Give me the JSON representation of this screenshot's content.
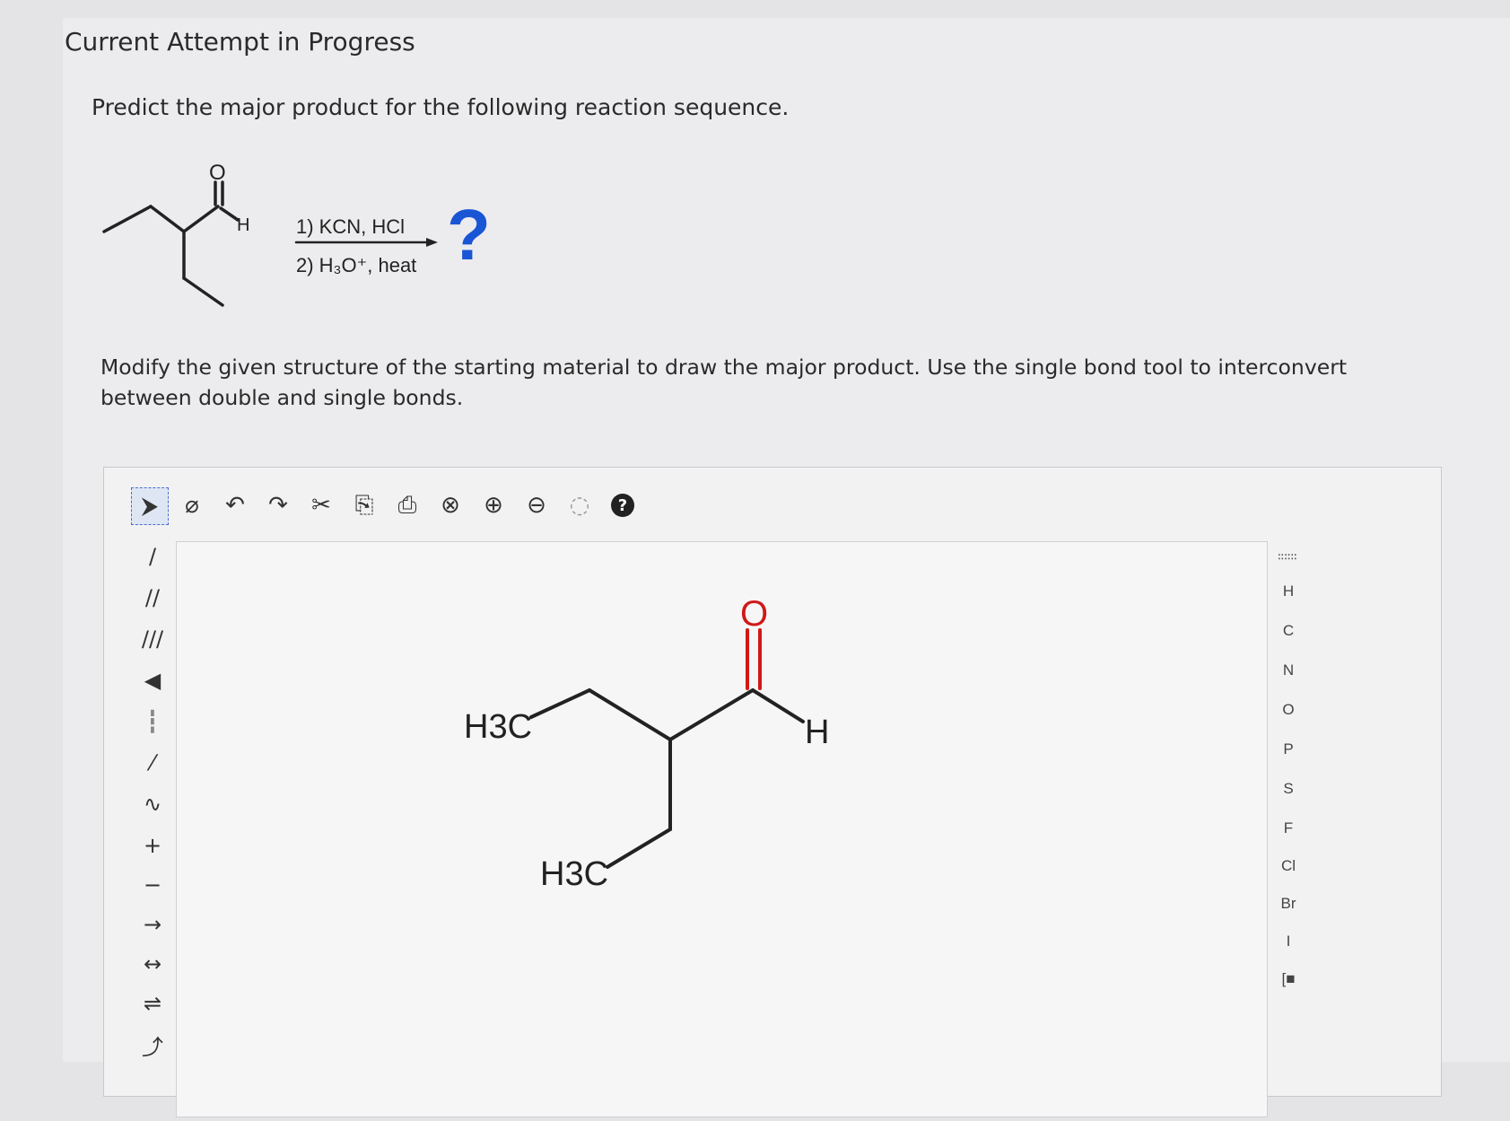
{
  "header": {
    "title": "Current Attempt in Progress"
  },
  "question": {
    "text": "Predict the major product for the following reaction sequence."
  },
  "reaction": {
    "reagent_1": "1) KCN, HCl",
    "reagent_2": "2) H₃O⁺, heat",
    "unknown": "?",
    "aldehyde_h": "H",
    "carbonyl_o": "O"
  },
  "instructions": {
    "text": "Modify the given structure of the starting material to draw the major product. Use the single bond tool to interconvert between double and single bonds."
  },
  "toolbar": {
    "items": [
      {
        "name": "select-tool-icon",
        "glyph": "⮞"
      },
      {
        "name": "eraser-icon",
        "glyph": "⌀"
      },
      {
        "name": "undo-icon",
        "glyph": "↶"
      },
      {
        "name": "redo-icon",
        "glyph": "↷"
      },
      {
        "name": "cut-icon",
        "glyph": "✂"
      },
      {
        "name": "copy-icon",
        "glyph": "⎘"
      },
      {
        "name": "paste-icon",
        "glyph": "⎙"
      },
      {
        "name": "zoom-reset-icon",
        "glyph": "⊗"
      },
      {
        "name": "zoom-in-icon",
        "glyph": "⊕"
      },
      {
        "name": "zoom-out-icon",
        "glyph": "⊖"
      },
      {
        "name": "zoom-fit-icon",
        "glyph": "◌"
      },
      {
        "name": "help-icon",
        "glyph": "?"
      }
    ]
  },
  "left_tools": {
    "items": [
      {
        "name": "single-bond-icon",
        "glyph": "/"
      },
      {
        "name": "double-bond-icon",
        "glyph": "//"
      },
      {
        "name": "triple-bond-icon",
        "glyph": "///"
      },
      {
        "name": "wedge-bond-icon",
        "glyph": "◀"
      },
      {
        "name": "hash-bond-icon",
        "glyph": "┇"
      },
      {
        "name": "dashed-bond-icon",
        "glyph": "⁄"
      },
      {
        "name": "chain-icon",
        "glyph": "∿"
      },
      {
        "name": "positive-charge-icon",
        "glyph": "+"
      },
      {
        "name": "negative-charge-icon",
        "glyph": "−"
      },
      {
        "name": "reaction-arrow-icon",
        "glyph": "→"
      },
      {
        "name": "resonance-arrow-icon",
        "glyph": "↔"
      },
      {
        "name": "equilibrium-arrow-icon",
        "glyph": "⇌"
      },
      {
        "name": "curved-arrow-icon",
        "glyph": "⤴"
      }
    ]
  },
  "atoms": {
    "periodic_table_label": "∷∷∷",
    "items": [
      "H",
      "C",
      "N",
      "O",
      "P",
      "S",
      "F",
      "Cl",
      "Br",
      "I"
    ],
    "bracket": "[■"
  },
  "canvas_molecule": {
    "ch3_upper": "H3C",
    "ch3_lower": "H3C",
    "aldehyde_h": "H",
    "oxygen": "O"
  }
}
